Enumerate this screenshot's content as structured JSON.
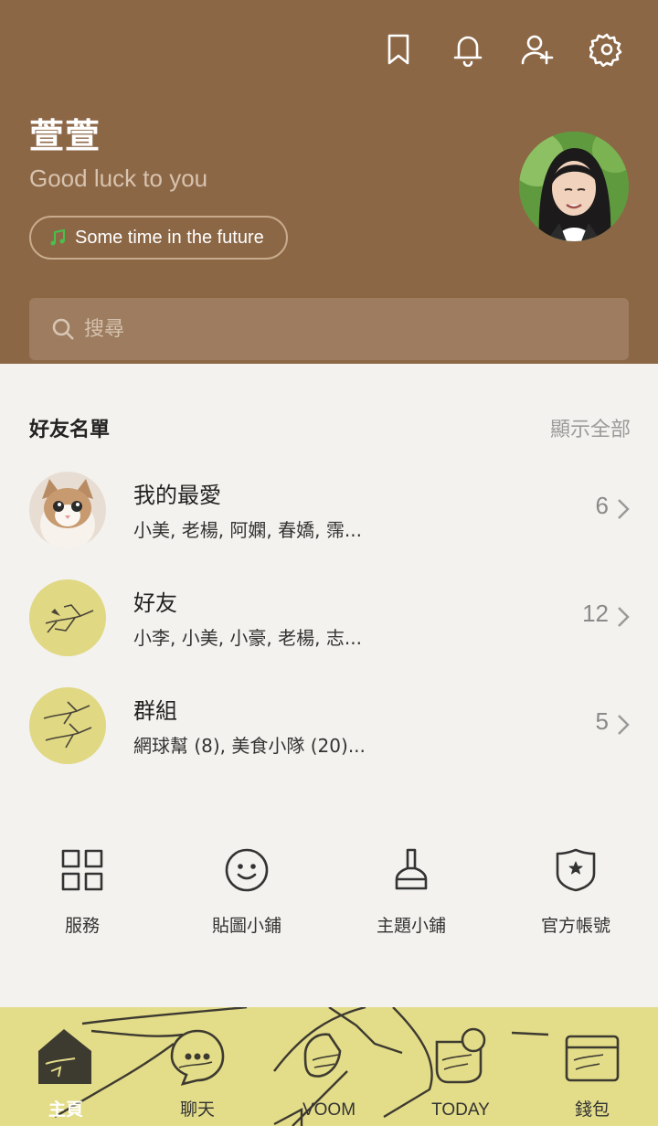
{
  "header": {
    "profile_name": "萱萱",
    "status_message": "Good luck to you",
    "music": "Some time in the future",
    "icons": [
      "bookmark-icon",
      "bell-icon",
      "add-friend-icon",
      "settings-icon"
    ]
  },
  "search": {
    "placeholder": "搜尋"
  },
  "friends": {
    "title": "好友名單",
    "show_all": "顯示全部",
    "groups": [
      {
        "name": "我的最愛",
        "members": "小美, 老楊, 阿嫻, 春嬌, 霈...",
        "count": "6"
      },
      {
        "name": "好友",
        "members": "小李, 小美, 小豪, 老楊, 志...",
        "count": "12"
      },
      {
        "name": "群組",
        "members": "網球幫 (8), 美食小隊 (20)...",
        "count": "5"
      }
    ]
  },
  "services": [
    {
      "label": "服務",
      "icon": "grid-icon"
    },
    {
      "label": "貼圖小鋪",
      "icon": "smiley-icon"
    },
    {
      "label": "主題小鋪",
      "icon": "brush-icon"
    },
    {
      "label": "官方帳號",
      "icon": "shield-star-icon"
    }
  ],
  "nav": [
    {
      "label": "主頁",
      "icon": "home-icon",
      "active": true
    },
    {
      "label": "聊天",
      "icon": "chat-icon"
    },
    {
      "label": "VOOM",
      "icon": "voom-icon"
    },
    {
      "label": "TODAY",
      "icon": "today-icon"
    },
    {
      "label": "錢包",
      "icon": "wallet-icon"
    }
  ],
  "colors": {
    "header_bg": "#8c6746",
    "nav_bg": "#e3dc89",
    "page_bg": "#f3f2ef"
  }
}
